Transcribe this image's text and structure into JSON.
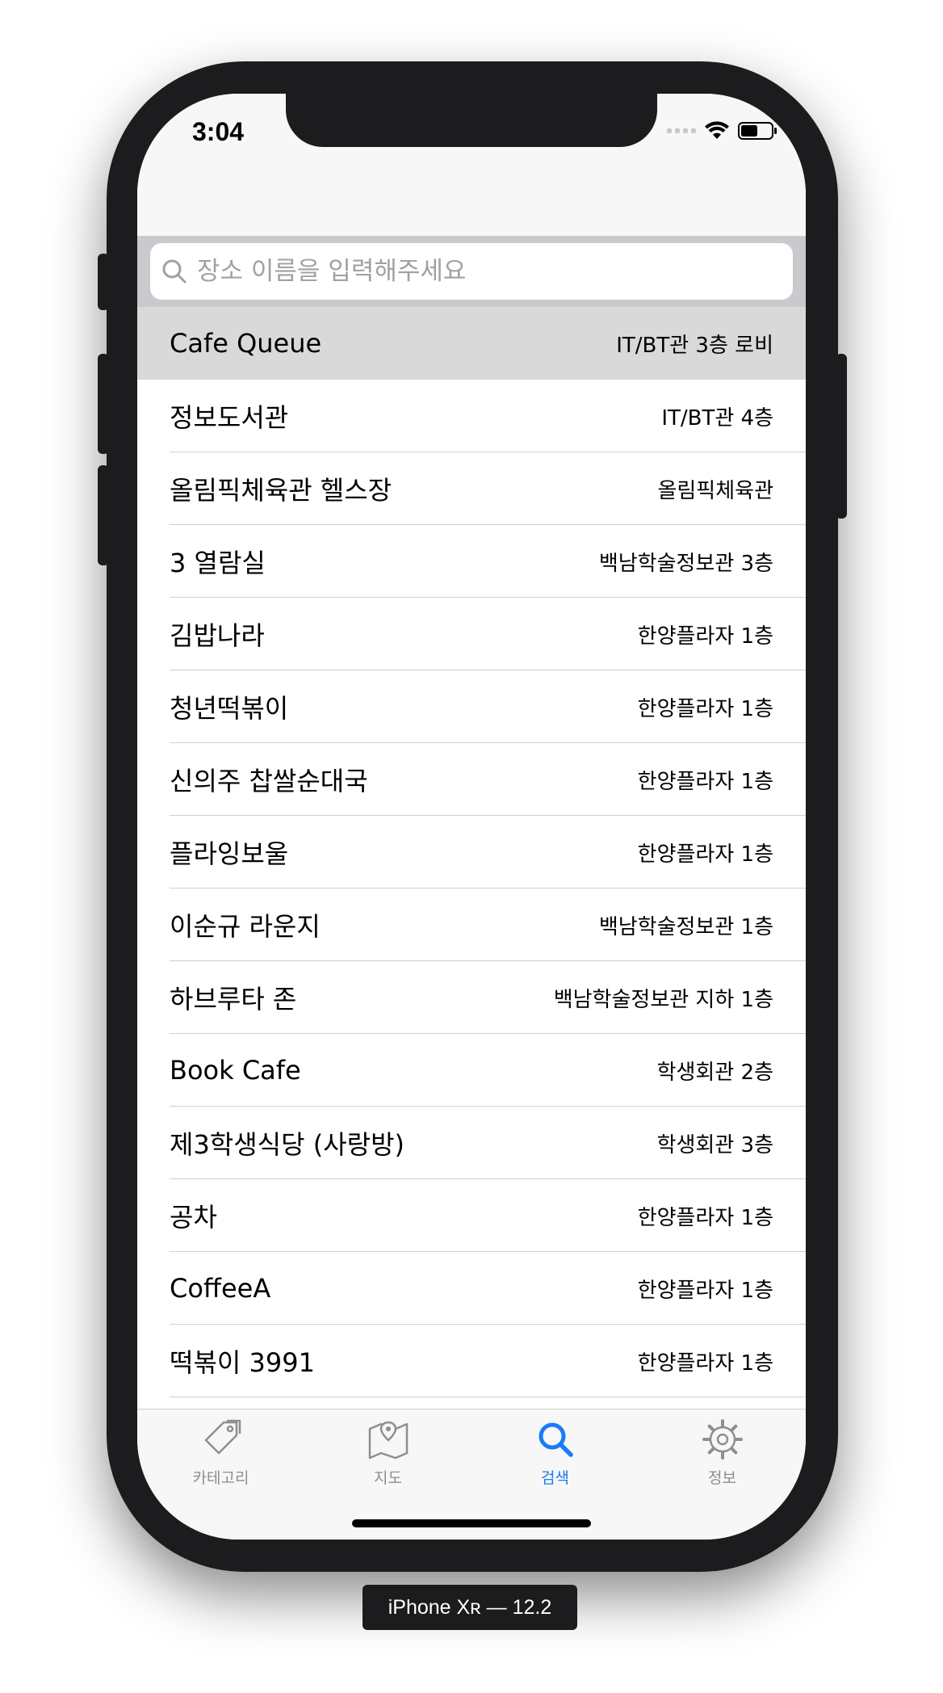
{
  "status_bar": {
    "time": "3:04"
  },
  "search": {
    "placeholder": "장소 이름을 입력해주세요",
    "value": ""
  },
  "places": [
    {
      "name": "Cafe Queue",
      "location": "IT/BT관 3층 로비",
      "selected": true
    },
    {
      "name": "정보도서관",
      "location": "IT/BT관 4층"
    },
    {
      "name": "올림픽체육관 헬스장",
      "location": "올림픽체육관"
    },
    {
      "name": "3 열람실",
      "location": "백남학술정보관 3층"
    },
    {
      "name": "김밥나라",
      "location": "한양플라자 1층"
    },
    {
      "name": "청년떡볶이",
      "location": "한양플라자 1층"
    },
    {
      "name": "신의주 찹쌀순대국",
      "location": "한양플라자 1층"
    },
    {
      "name": "플라잉보울",
      "location": "한양플라자 1층"
    },
    {
      "name": "이순규 라운지",
      "location": "백남학술정보관 1층"
    },
    {
      "name": "하브루타 존",
      "location": "백남학술정보관 지하 1층"
    },
    {
      "name": "Book Cafe",
      "location": "학생회관 2층"
    },
    {
      "name": "제3학생식당 (사랑방)",
      "location": "학생회관 3층"
    },
    {
      "name": "공차",
      "location": "한양플라자 1층"
    },
    {
      "name": "CoffeeA",
      "location": "한양플라자 1층"
    },
    {
      "name": "떡볶이 3991",
      "location": "한양플라자 1층"
    }
  ],
  "tabs": [
    {
      "label": "카테고리",
      "icon": "tag-icon",
      "active": false
    },
    {
      "label": "지도",
      "icon": "map-icon",
      "active": false
    },
    {
      "label": "검색",
      "icon": "search-icon",
      "active": true
    },
    {
      "label": "정보",
      "icon": "gear-icon",
      "active": false
    }
  ],
  "device_label": "iPhone Xʀ — 12.2",
  "colors": {
    "accent": "#1a7cf5",
    "selected_row": "#d9d9d9",
    "inactive_tab": "#8e8e93"
  }
}
